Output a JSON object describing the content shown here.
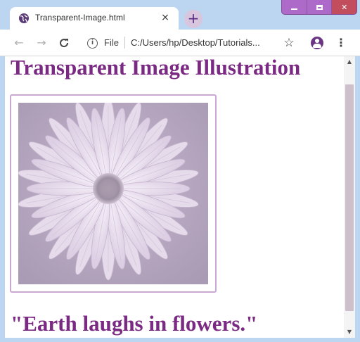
{
  "browser": {
    "tab_title": "Transparent-Image.html",
    "tab_close_glyph": "×",
    "new_tab_glyph": "+",
    "favicon_icon": "globe-icon",
    "window_controls": [
      "minimize",
      "maximize",
      "close"
    ],
    "close_glyph": "✕",
    "toolbar": {
      "back_glyph": "←",
      "forward_glyph": "→",
      "reload_glyph": "C",
      "info_glyph": "i",
      "scheme_label": "File",
      "url": "C:/Users/hp/Desktop/Tutorials...",
      "star_glyph": "☆",
      "menu_glyph": "⋮"
    }
  },
  "page": {
    "heading": "Transparent Image Illustration",
    "quote": "\"Earth laughs in flowers.\"",
    "image_alt": "daisy-flower",
    "colors": {
      "heading": "#7b2a83",
      "image_border": "#c9a9d4"
    }
  },
  "scrollbar": {
    "up_glyph": "▲",
    "down_glyph": "▼"
  }
}
